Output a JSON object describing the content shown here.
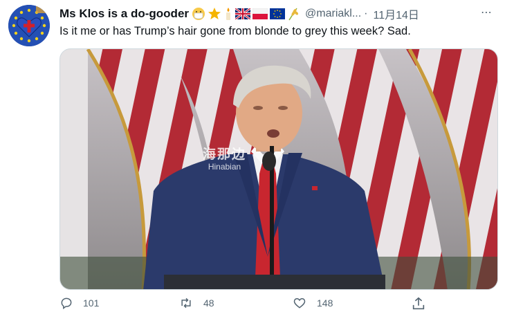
{
  "tweet": {
    "display_name": "Ms Klos is a do-gooder",
    "name_emojis": [
      "mask-face-emoji",
      "star-emoji",
      "candle-emoji",
      "uk-flag-emoji",
      "poland-flag-emoji",
      "eu-flag-emoji",
      "wheat-emoji"
    ],
    "handle": "@mariakl...",
    "separator": "·",
    "timestamp": "11月14日",
    "more_label": "⋯",
    "text": "Is it me or has Trump’s hair gone from blonde to grey this week? Sad.",
    "media": {
      "watermark_zh": "海那边",
      "watermark_en": "Hinabian"
    },
    "actions": {
      "replies": "101",
      "retweets": "48",
      "likes": "148"
    }
  },
  "colors": {
    "text": "#0f1419",
    "secondary": "#536471",
    "suit": "#2b3a6b",
    "tie": "#c8262f",
    "flag_red": "#b32a35"
  }
}
